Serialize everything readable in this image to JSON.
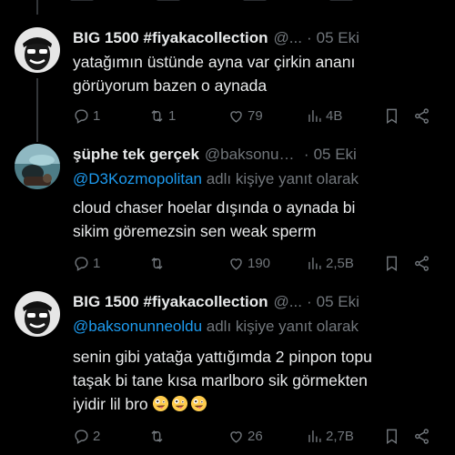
{
  "colors": {
    "background": "#000000",
    "text": "#e7e9ea",
    "muted": "#71767b",
    "link": "#1d9bf0"
  },
  "tweets": [
    {
      "display_name": "BIG 1500 #fiyakacollection",
      "handle": "@...",
      "date": "05 Eki",
      "text_lines": [
        "yatağımın üstünde ayna var çirkin ananı",
        "görüyorum bazen o aynada"
      ],
      "replies": "1",
      "reposts": "1",
      "likes": "79",
      "views": "4B"
    },
    {
      "display_name": "şüphe tek gerçek",
      "handle": "@baksonunn...",
      "date": "05 Eki",
      "reply_mention": "@D3Kozmopolitan",
      "reply_suffix": " adlı kişiye yanıt olarak",
      "text_lines": [
        "cloud chaser hoelar dışında o aynada bi",
        "sikim göremezsin sen weak sperm"
      ],
      "replies": "1",
      "reposts": "",
      "likes": "190",
      "views": "2,5B"
    },
    {
      "display_name": "BIG 1500 #fiyakacollection",
      "handle": "@...",
      "date": "05 Eki",
      "reply_mention": "@baksonunneoldu",
      "reply_suffix": " adlı kişiye yanıt olarak",
      "text_lines": [
        "senin gibi yatağa yattığımda 2 pinpon topu",
        "taşak bi tane kısa marlboro sik görmekten",
        "iyidir lil bro"
      ],
      "emoji_icons": [
        "zany-face-emoji",
        "zany-face-emoji",
        "zany-face-emoji"
      ],
      "replies": "2",
      "reposts": "",
      "likes": "26",
      "views": "2,7B"
    }
  ]
}
